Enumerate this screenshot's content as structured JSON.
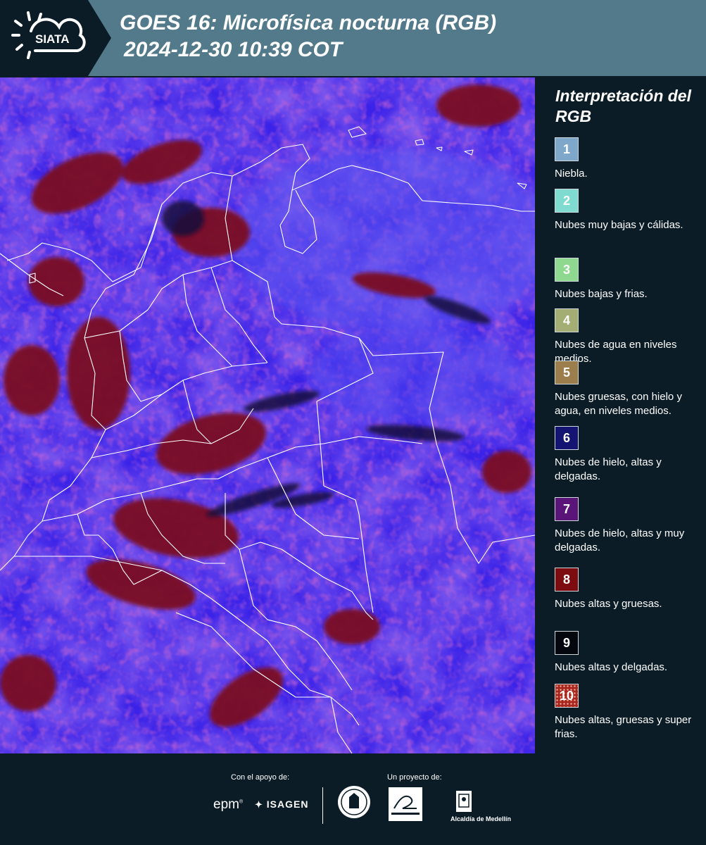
{
  "header": {
    "brand": "SIATA",
    "title_line1": "GOES 16: Microfísica nocturna (RGB)",
    "title_line2": "2024-12-30 10:39 COT",
    "background_color": "#527a8a"
  },
  "legend": {
    "title": "Interpretación del RGB",
    "items": [
      {
        "number": "1",
        "color": "#7fa7c9",
        "label": "Niebla."
      },
      {
        "number": "2",
        "color": "#7fdad0",
        "label": "Nubes muy bajas y cálidas."
      },
      {
        "number": "3",
        "color": "#8ed98f",
        "label": "Nubes bajas y frias."
      },
      {
        "number": "4",
        "color": "#a4ad73",
        "label": "Nubes de agua en niveles medios."
      },
      {
        "number": "5",
        "color": "#9c7d4c",
        "label": "Nubes gruesas, con hielo y agua, en niveles medios."
      },
      {
        "number": "6",
        "color": "#141472",
        "label": "Nubes de hielo, altas y delgadas."
      },
      {
        "number": "7",
        "color": "#5b1578",
        "label": "Nubes de hielo, altas y muy delgadas."
      },
      {
        "number": "8",
        "color": "#7d0c10",
        "label": "Nubes altas y gruesas."
      },
      {
        "number": "9",
        "color": "#05070e",
        "label": "Nubes altas y delgadas."
      },
      {
        "number": "10",
        "color": "#a8261e",
        "label": "Nubes altas, gruesas y super frias."
      }
    ]
  },
  "footer": {
    "support_label": "Con el apoyo de:",
    "project_label": "Un proyecto de:",
    "epm": "epm",
    "isagen": "ISAGEN",
    "alcaldia": "Alcaldía de Medellín"
  }
}
